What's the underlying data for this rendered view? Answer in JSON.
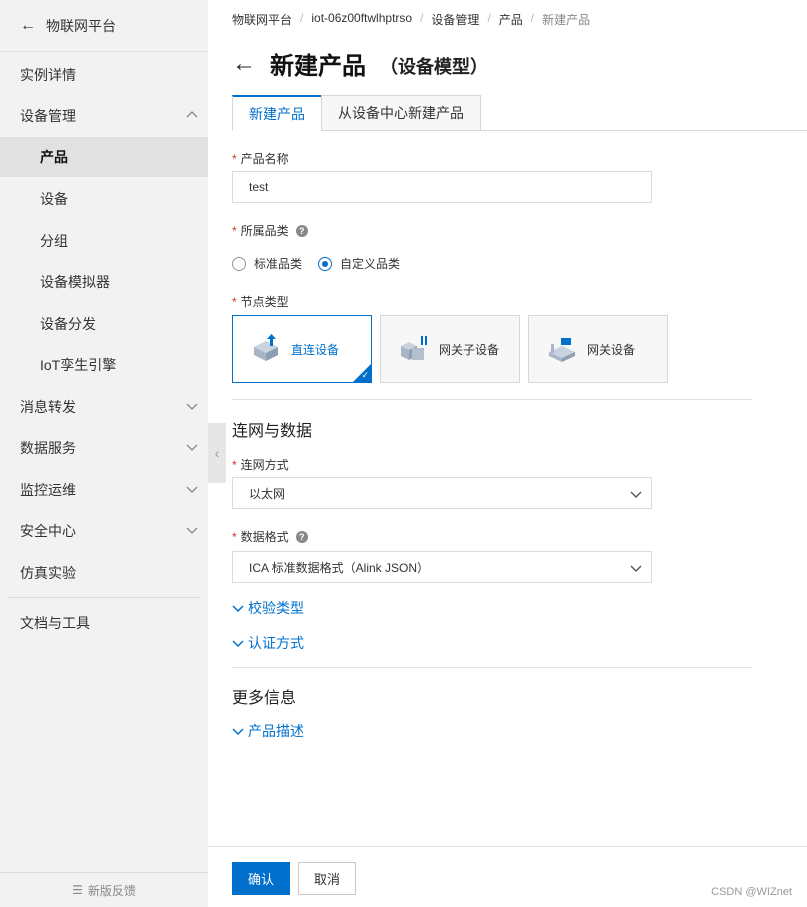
{
  "sidebar": {
    "header": "物联网平台",
    "items": [
      {
        "label": "实例详情"
      },
      {
        "label": "设备管理"
      },
      {
        "label": "产品"
      },
      {
        "label": "设备"
      },
      {
        "label": "分组"
      },
      {
        "label": "设备模拟器"
      },
      {
        "label": "设备分发"
      },
      {
        "label": "IoT孪生引擎"
      },
      {
        "label": "消息转发"
      },
      {
        "label": "数据服务"
      },
      {
        "label": "监控运维"
      },
      {
        "label": "安全中心"
      },
      {
        "label": "仿真实验"
      },
      {
        "label": "文档与工具"
      }
    ],
    "footer": "新版反馈"
  },
  "breadcrumb": [
    "物联网平台",
    "iot-06z00ftwlhptrso",
    "设备管理",
    "产品",
    "新建产品"
  ],
  "page": {
    "title": "新建产品",
    "subtitle": "（设备模型）"
  },
  "tabs": [
    {
      "label": "新建产品"
    },
    {
      "label": "从设备中心新建产品"
    }
  ],
  "form": {
    "product_name_label": "产品名称",
    "product_name_value": "test",
    "category_label": "所属品类",
    "category_options": [
      "标准品类",
      "自定义品类"
    ],
    "category_selected": "自定义品类",
    "node_type_label": "节点类型",
    "node_types": [
      "直连设备",
      "网关子设备",
      "网关设备"
    ],
    "node_type_selected": "直连设备",
    "network_section": "连网与数据",
    "network_label": "连网方式",
    "network_value": "以太网",
    "data_format_label": "数据格式",
    "data_format_value": "ICA 标准数据格式（Alink JSON）",
    "checksum_expander": "校验类型",
    "auth_expander": "认证方式",
    "more_section": "更多信息",
    "description_expander": "产品描述"
  },
  "actions": {
    "confirm": "确认",
    "cancel": "取消"
  },
  "watermark": "CSDN @WIZnet",
  "colors": {
    "accent": "#0070cc",
    "required": "#d93026"
  },
  "icons": {
    "back": "arrow-left-icon",
    "chevron": "chevron-icon",
    "help": "question-icon"
  }
}
